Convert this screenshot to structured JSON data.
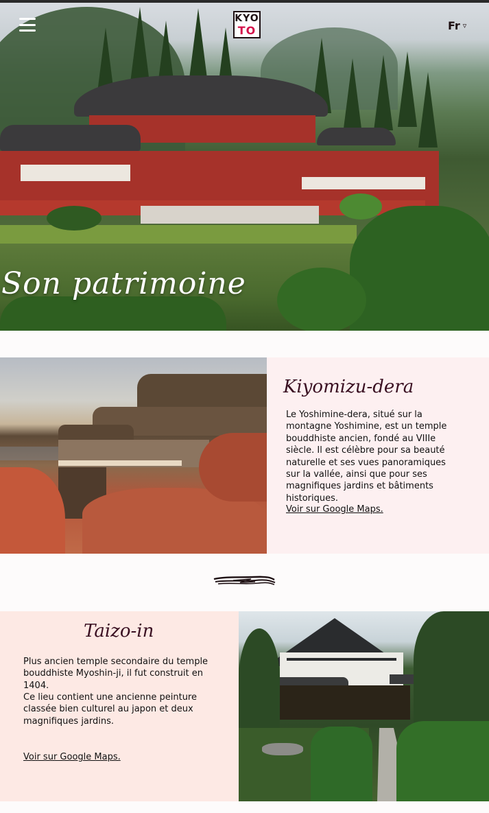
{
  "header": {
    "logo_top": "KYO",
    "logo_bottom": "TO",
    "language": "Fr",
    "language_chevron": "▿"
  },
  "hero": {
    "title": "Son patrimoine"
  },
  "sections": [
    {
      "title": "Kiyomizu-dera",
      "paragraphs": [
        "Le Yoshimine-dera, situé sur la montagne Yoshimine, est un temple bouddhiste ancien, fondé au VIIIe siècle. Il est célèbre pour sa beauté naturelle et ses vues panoramiques sur la vallée, ainsi que pour ses magnifiques jardins et bâtiments historiques."
      ],
      "link": "Voir sur Google Maps."
    },
    {
      "title": "Taizo-in",
      "paragraphs": [
        "Plus ancien temple secondaire du temple bouddhiste Myoshin-ji, il fut construit en 1404.",
        "Ce lieu contient une ancienne peinture classée bien culturel au japon et deux magnifiques jardins."
      ],
      "link": "Voir sur Google Maps."
    }
  ],
  "colors": {
    "accent": "#d4124b",
    "card_pink": "#fdf0f1",
    "card_peach": "#fde9e4",
    "title_color": "#3a1022"
  },
  "icons": {
    "menu": "hamburger-icon",
    "divider": "brush-stroke-divider"
  }
}
